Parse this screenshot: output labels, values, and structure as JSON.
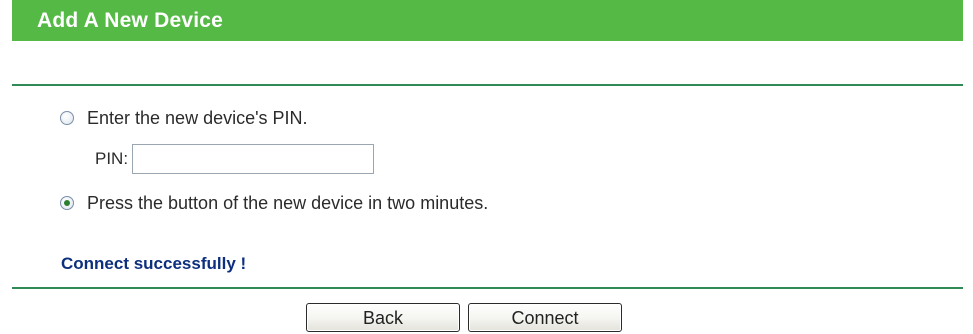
{
  "header": {
    "title": "Add A New Device"
  },
  "options": {
    "pin_option_label": "Enter the new device's PIN.",
    "pin_label": "PIN:",
    "pin_value": "",
    "pbc_option_label": "Press the button of the new device in two minutes.",
    "selected": "pbc"
  },
  "status": {
    "message": "Connect successfully !"
  },
  "buttons": {
    "back_label": "Back",
    "connect_label": "Connect"
  },
  "colors": {
    "header_bg": "#55b946",
    "divider": "#2f8a56",
    "status_text": "#0d2f7e"
  }
}
